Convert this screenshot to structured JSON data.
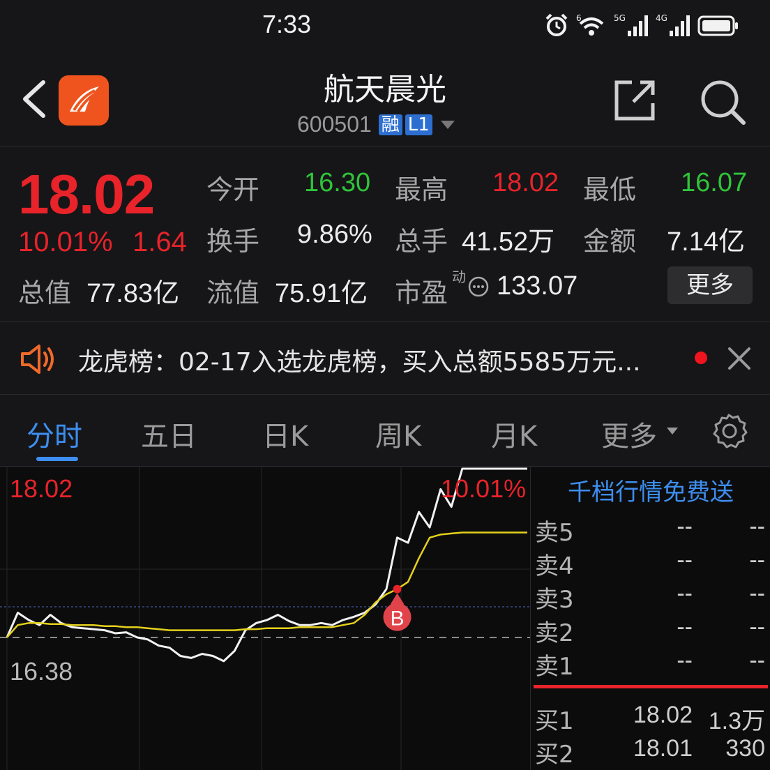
{
  "status_bar": {
    "time": "7:33",
    "wifi_label": "6",
    "signal1_label": "5G",
    "signal2_label": "4G",
    "icons": [
      "alarm-icon",
      "wifi-icon",
      "signal-5g-icon",
      "signal-4g-icon",
      "battery-icon"
    ]
  },
  "header": {
    "stock_name": "航天晨光",
    "stock_code": "600501",
    "tag_margin": "融",
    "tag_level": "L1"
  },
  "quote": {
    "price": "18.02",
    "change_pct": "10.01%",
    "change_val": "1.64",
    "open_label": "今开",
    "open_val": "16.30",
    "high_label": "最高",
    "high_val": "18.02",
    "low_label": "最低",
    "low_val": "16.07",
    "turnover_label": "换手",
    "turnover_val": "9.86%",
    "volume_label": "总手",
    "volume_val": "41.52万",
    "amount_label": "金额",
    "amount_val": "7.14亿",
    "mktcap_label": "总值",
    "mktcap_val": "77.83亿",
    "float_label": "流值",
    "float_val": "75.91亿",
    "pe_label": "市盈",
    "pe_sup": "动",
    "pe_val": "133.07",
    "more_label": "更多"
  },
  "notice": {
    "text": "龙虎榜：02-17入选龙虎榜，买入总额5585万元..."
  },
  "tabs": {
    "items": [
      "分时",
      "五日",
      "日K",
      "周K",
      "月K",
      "更多"
    ],
    "active": 0
  },
  "chart_data": {
    "type": "line",
    "title": "",
    "max_label": "18.02",
    "max_pct_label": "10.01%",
    "prev_close_label": "16.38",
    "prev_close": 16.38,
    "ylim": [
      16.0,
      18.02
    ],
    "x": [
      0,
      5,
      10,
      15,
      20,
      25,
      30,
      35,
      40,
      45,
      50,
      55,
      60,
      65,
      70,
      75,
      80,
      85,
      90,
      95,
      100,
      105,
      110,
      115,
      120,
      125,
      130,
      135,
      140,
      145,
      150,
      155,
      160,
      165,
      170,
      175,
      180,
      185,
      190,
      195,
      200,
      205,
      210,
      215,
      220,
      225,
      230,
      235,
      240
    ],
    "series": [
      {
        "values": [
          16.38,
          16.62,
          16.55,
          16.5,
          16.6,
          16.52,
          16.48,
          16.47,
          16.46,
          16.45,
          16.42,
          16.43,
          16.38,
          16.36,
          16.3,
          16.28,
          16.2,
          16.18,
          16.22,
          16.2,
          16.15,
          16.25,
          16.45,
          16.52,
          16.55,
          16.6,
          16.54,
          16.5,
          16.5,
          16.52,
          16.5,
          16.55,
          16.58,
          16.62,
          16.7,
          16.85,
          17.35,
          17.3,
          17.6,
          17.45,
          17.82,
          17.65,
          18.02,
          18.02,
          18.02,
          18.02,
          18.02,
          18.02,
          18.02
        ]
      },
      {
        "values": [
          16.38,
          16.5,
          16.52,
          16.52,
          16.51,
          16.51,
          16.5,
          16.5,
          16.5,
          16.49,
          16.49,
          16.48,
          16.48,
          16.47,
          16.46,
          16.45,
          16.45,
          16.45,
          16.45,
          16.45,
          16.45,
          16.45,
          16.46,
          16.46,
          16.47,
          16.47,
          16.47,
          16.48,
          16.48,
          16.48,
          16.48,
          16.5,
          16.52,
          16.6,
          16.72,
          16.8,
          16.85,
          16.92,
          17.15,
          17.35,
          17.38,
          17.39,
          17.4,
          17.4,
          17.4,
          17.4,
          17.4,
          17.4,
          17.4
        ]
      }
    ],
    "marker": {
      "label": "B",
      "x": 180,
      "y": 16.85
    }
  },
  "order_book": {
    "promo": "千档行情免费送",
    "asks": [
      {
        "label": "卖5",
        "price": "--",
        "vol": "--"
      },
      {
        "label": "卖4",
        "price": "--",
        "vol": "--"
      },
      {
        "label": "卖3",
        "price": "--",
        "vol": "--"
      },
      {
        "label": "卖2",
        "price": "--",
        "vol": "--"
      },
      {
        "label": "卖1",
        "price": "--",
        "vol": "--"
      }
    ],
    "bids": [
      {
        "label": "买1",
        "price": "18.02",
        "vol": "1.3万"
      },
      {
        "label": "买2",
        "price": "18.01",
        "vol": "330"
      }
    ]
  },
  "colors": {
    "up": "#e8232a",
    "down": "#2fc43a",
    "accent": "#3d8ef0",
    "price_line": "#f2f2f2",
    "avg_line": "#e4d11c"
  }
}
